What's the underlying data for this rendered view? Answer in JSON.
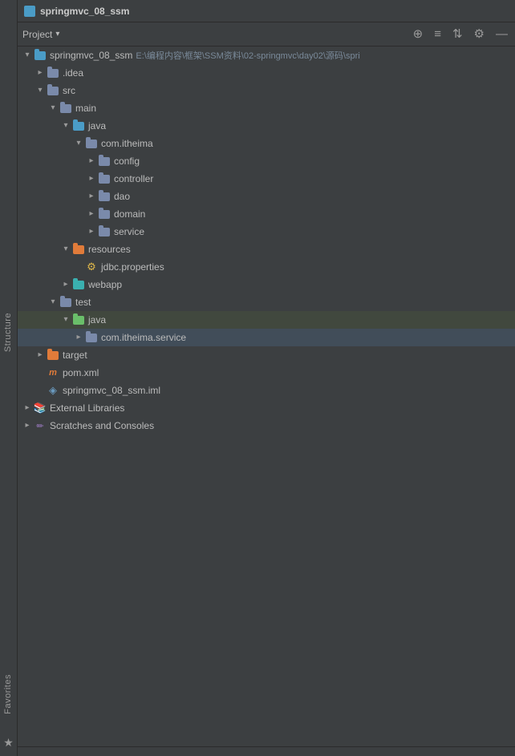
{
  "titleBar": {
    "icon": "module-icon",
    "title": "springmvc_08_ssm"
  },
  "toolbar": {
    "label": "Project",
    "chevron": "▾",
    "buttons": [
      "⊕",
      "≡",
      "⇅",
      "⚙",
      "—"
    ]
  },
  "tree": {
    "items": [
      {
        "id": "root",
        "label": "springmvc_08_ssm",
        "path": "E:\\编程内容\\框架\\SSM资料\\02-springmvc\\day02\\源码\\spri",
        "indent": 0,
        "arrow": "expanded",
        "iconType": "folder-blue",
        "selected": false
      },
      {
        "id": "idea",
        "label": ".idea",
        "indent": 1,
        "arrow": "collapsed",
        "iconType": "folder",
        "selected": false
      },
      {
        "id": "src",
        "label": "src",
        "indent": 1,
        "arrow": "expanded",
        "iconType": "folder",
        "selected": false
      },
      {
        "id": "main",
        "label": "main",
        "indent": 2,
        "arrow": "expanded",
        "iconType": "folder",
        "selected": false
      },
      {
        "id": "java",
        "label": "java",
        "indent": 3,
        "arrow": "expanded",
        "iconType": "folder-blue",
        "selected": false
      },
      {
        "id": "com.itheima",
        "label": "com.itheima",
        "indent": 4,
        "arrow": "expanded",
        "iconType": "folder",
        "selected": false
      },
      {
        "id": "config",
        "label": "config",
        "indent": 5,
        "arrow": "collapsed",
        "iconType": "folder",
        "selected": false
      },
      {
        "id": "controller",
        "label": "controller",
        "indent": 5,
        "arrow": "collapsed",
        "iconType": "folder",
        "selected": false
      },
      {
        "id": "dao",
        "label": "dao",
        "indent": 5,
        "arrow": "collapsed",
        "iconType": "folder",
        "selected": false
      },
      {
        "id": "domain",
        "label": "domain",
        "indent": 5,
        "arrow": "collapsed",
        "iconType": "folder",
        "selected": false
      },
      {
        "id": "service",
        "label": "service",
        "indent": 5,
        "arrow": "collapsed",
        "iconType": "folder",
        "selected": false
      },
      {
        "id": "resources",
        "label": "resources",
        "indent": 3,
        "arrow": "expanded",
        "iconType": "folder-orange",
        "selected": false
      },
      {
        "id": "jdbc.properties",
        "label": "jdbc.properties",
        "indent": 4,
        "arrow": "none",
        "iconType": "properties",
        "selected": false
      },
      {
        "id": "webapp",
        "label": "webapp",
        "indent": 3,
        "arrow": "collapsed",
        "iconType": "folder-cyan",
        "selected": false
      },
      {
        "id": "test",
        "label": "test",
        "indent": 2,
        "arrow": "expanded",
        "iconType": "folder",
        "selected": false
      },
      {
        "id": "java-test",
        "label": "java",
        "indent": 3,
        "arrow": "expanded",
        "iconType": "folder-green",
        "selected": false,
        "highlighted": true
      },
      {
        "id": "com.itheima.service",
        "label": "com.itheima.service",
        "indent": 4,
        "arrow": "collapsed",
        "iconType": "folder",
        "selected": true
      },
      {
        "id": "target",
        "label": "target",
        "indent": 1,
        "arrow": "collapsed",
        "iconType": "folder-orange",
        "selected": false
      },
      {
        "id": "pom.xml",
        "label": "pom.xml",
        "indent": 1,
        "arrow": "none",
        "iconType": "xml",
        "selected": false
      },
      {
        "id": "springmvc_08_ssm.iml",
        "label": "springmvc_08_ssm.iml",
        "indent": 1,
        "arrow": "none",
        "iconType": "iml",
        "selected": false
      },
      {
        "id": "external-libraries",
        "label": "External Libraries",
        "indent": 0,
        "arrow": "collapsed",
        "iconType": "ext-libraries",
        "selected": false
      },
      {
        "id": "scratches",
        "label": "Scratches and Consoles",
        "indent": 0,
        "arrow": "collapsed",
        "iconType": "scratches",
        "selected": false
      }
    ]
  },
  "sidebar": {
    "tabs": [
      {
        "label": "Structure",
        "position": "middle"
      },
      {
        "label": "Favorites",
        "position": "bottom"
      }
    ]
  }
}
